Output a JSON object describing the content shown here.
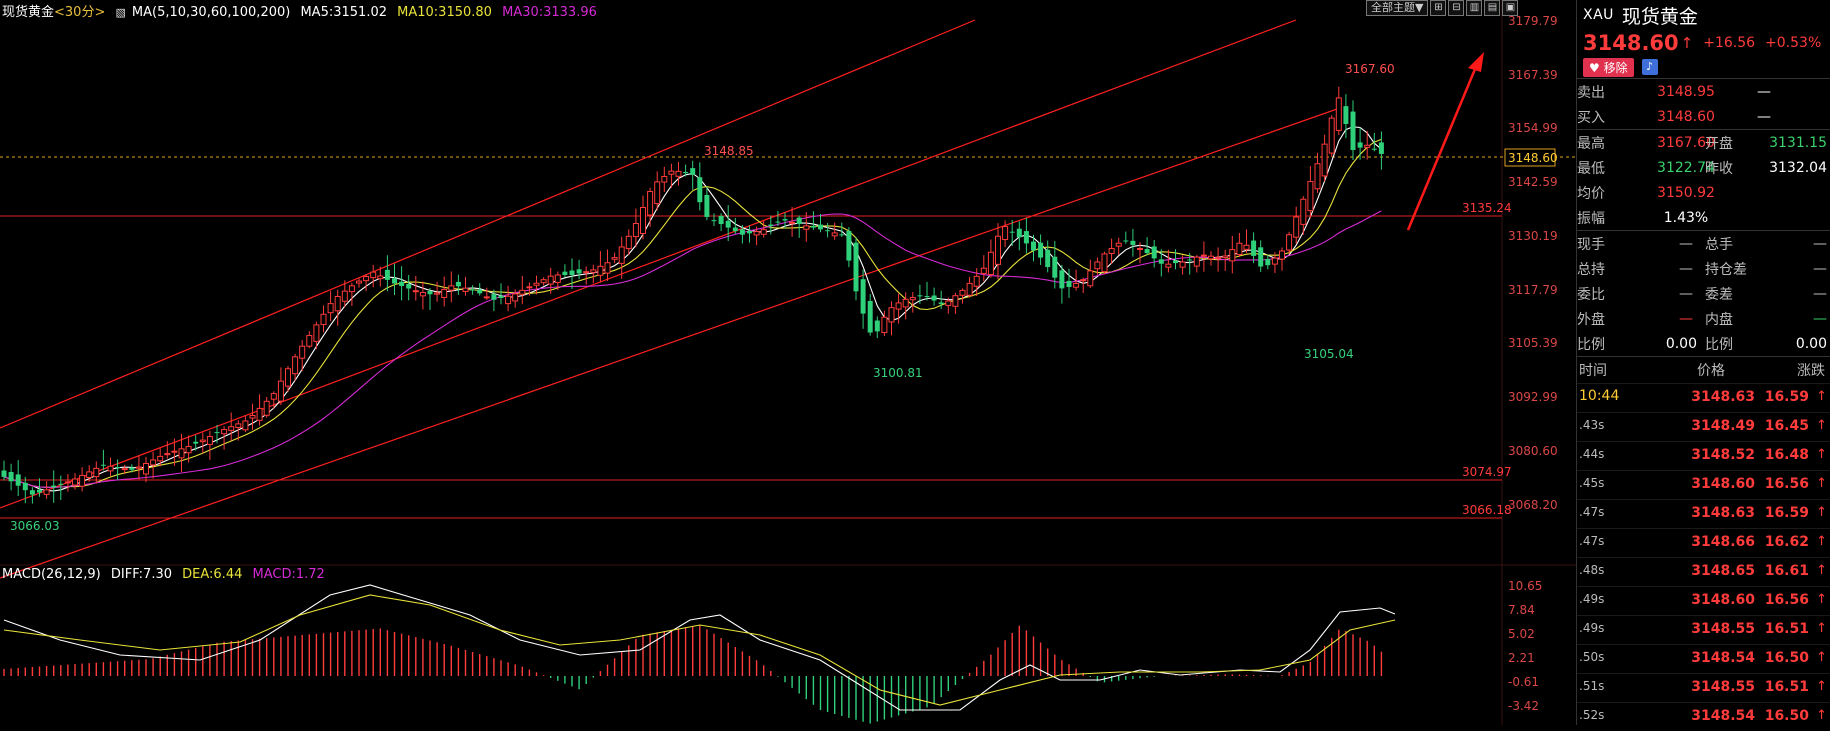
{
  "header": {
    "symbol_name": "现货黄金",
    "period": "<30分>",
    "ma_params": "MA(5,10,30,60,100,200)",
    "ma5": "MA5:3151.02",
    "ma10": "MA10:3150.80",
    "ma30": "MA30:3133.96"
  },
  "toolbar": {
    "theme_label": "全部主题▼",
    "icons": [
      "grid-icon",
      "grid-icon",
      "layout-icon",
      "layout-icon",
      "layout-icon"
    ]
  },
  "colors": {
    "bg": "#000000",
    "up": "#ff3b3b",
    "down": "#2fd07a",
    "ma5": "#ffffff",
    "ma10": "#e8e23a",
    "ma30": "#d52bd5",
    "channel": "#ff2a2a",
    "grid": "#2a0c0c"
  },
  "price_axis": {
    "labels": [
      "3179.79",
      "3167.39",
      "3154.99",
      "3142.59",
      "3130.19",
      "3117.79",
      "3105.39",
      "3092.99",
      "3080.60",
      "3068.20"
    ],
    "current_tag": "3148.60"
  },
  "levels": [
    {
      "value": "3135.24"
    },
    {
      "value": "3074.97"
    },
    {
      "value": "3066.18"
    }
  ],
  "annotations": {
    "high_right": "3167.60",
    "high_mid": "3148.85",
    "low_mid": "3100.81",
    "low_right": "3105.04",
    "low_left": "3066.03"
  },
  "macd": {
    "legend_name": "MACD(26,12,9)",
    "diff": "DIFF:7.30",
    "dea": "DEA:6.44",
    "macd": "MACD:1.72",
    "axis": [
      "10.65",
      "7.84",
      "5.02",
      "2.21",
      "-0.61",
      "-3.42"
    ]
  },
  "quote": {
    "code": "XAU",
    "name": "现货黄金",
    "price": "3148.60",
    "arrow": "↑",
    "change": "+16.56",
    "change_pct": "+0.53%",
    "remove_label": "♥ 移除",
    "bell_icon": "bell-icon",
    "rows": {
      "sell_label": "卖出",
      "sell_value": "3148.95",
      "sell_extra": "—",
      "buy_label": "买入",
      "buy_value": "3148.60",
      "buy_extra": "—",
      "high_label": "最高",
      "high_value": "3167.60",
      "open_label": "开盘",
      "open_value": "3131.15",
      "low_label": "最低",
      "low_value": "3122.74",
      "prev_label": "昨收",
      "prev_value": "3132.04",
      "avg_label": "均价",
      "avg_value": "3150.92",
      "amp_label": "振幅",
      "amp_value": "1.43%",
      "now_hand_label": "现手",
      "now_hand_value": "—",
      "total_hand_label": "总手",
      "total_hand_value": "—",
      "hold_label": "总持",
      "hold_value": "—",
      "hold_diff_label": "持仓差",
      "hold_diff_value": "—",
      "ratio_label": "委比",
      "ratio_value": "—",
      "diff_label": "委差",
      "diff_value": "—",
      "outer_label": "外盘",
      "outer_value": "—",
      "inner_label": "内盘",
      "inner_value": "—",
      "pct_label": "比例",
      "pct_value": "0.00",
      "pct2_label": "比例",
      "pct2_value": "0.00"
    },
    "ticks_header": {
      "time": "时间",
      "price": "价格",
      "change": "涨跌"
    },
    "ticks": [
      {
        "time": "10:44",
        "price": "3148.63",
        "change": "16.59"
      },
      {
        "time": ".43s",
        "price": "3148.49",
        "change": "16.45"
      },
      {
        "time": ".44s",
        "price": "3148.52",
        "change": "16.48"
      },
      {
        "time": ".45s",
        "price": "3148.60",
        "change": "16.56"
      },
      {
        "time": ".47s",
        "price": "3148.63",
        "change": "16.59"
      },
      {
        "time": ".47s",
        "price": "3148.66",
        "change": "16.62"
      },
      {
        "time": ".48s",
        "price": "3148.65",
        "change": "16.61"
      },
      {
        "time": ".49s",
        "price": "3148.60",
        "change": "16.56"
      },
      {
        "time": ".49s",
        "price": "3148.55",
        "change": "16.51"
      },
      {
        "time": ".50s",
        "price": "3148.54",
        "change": "16.50"
      },
      {
        "time": ".51s",
        "price": "3148.55",
        "change": "16.51"
      },
      {
        "time": ".52s",
        "price": "3148.54",
        "change": "16.50"
      }
    ],
    "tick_arrow": "↑"
  }
}
